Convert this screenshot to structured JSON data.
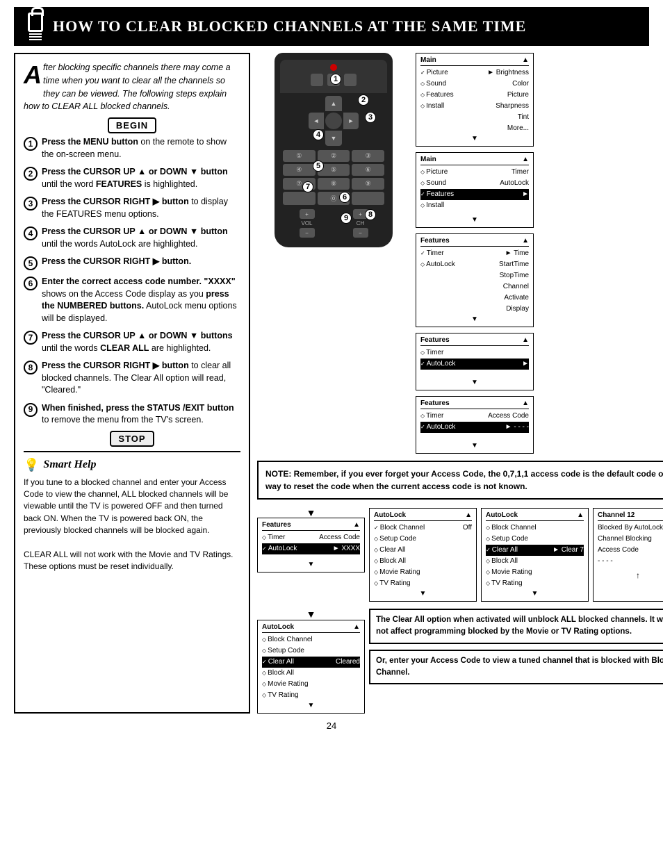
{
  "header": {
    "title": "How to Clear Blocked Channels at the Same Time"
  },
  "intro": {
    "drop_cap": "A",
    "text": "fter blocking specific channels there may come a time when you want to clear all the channels so they can be viewed. The following steps explain how to CLEAR ALL blocked channels."
  },
  "begin_label": "BEGIN",
  "stop_label": "STOP",
  "steps": [
    {
      "num": "1",
      "text": "Press the MENU button on the remote to show the on-screen menu."
    },
    {
      "num": "2",
      "text": "Press the CURSOR UP ▲ or DOWN ▼ button until the word FEATURES is highlighted."
    },
    {
      "num": "3",
      "text": "Press the CURSOR RIGHT ▶ button to display the FEATURES menu options."
    },
    {
      "num": "4",
      "text": "Press the CURSOR UP ▲ or DOWN ▼ button until the words AutoLock are highlighted."
    },
    {
      "num": "5",
      "text": "Press the CURSOR RIGHT ▶ button."
    },
    {
      "num": "6",
      "text": "Enter the correct access code number. \"XXXX\" shows on the Access Code display as you press the NUMBERED buttons. AutoLock menu options will be displayed."
    },
    {
      "num": "7",
      "text": "Press the CURSOR UP ▲ or DOWN ▼ buttons until the words CLEAR ALL are highlighted."
    },
    {
      "num": "8",
      "text": "Press the CURSOR RIGHT ▶ button to clear all blocked channels. The Clear All option will read, \"Cleared.\""
    },
    {
      "num": "9",
      "text": "When finished, press the STATUS /EXIT button to remove the menu from the TV's screen."
    }
  ],
  "smart_help": {
    "title": "Smart Help",
    "text": "If you tune to a blocked channel and enter your Access Code to view the channel, ALL blocked channels will be viewable until the TV is powered OFF and then turned back ON. When the TV is powered back ON, the previously blocked channels will be blocked again.\n\nCLEAR ALL will not work with the Movie and TV Ratings. These options must be reset individually."
  },
  "note": {
    "text": "NOTE: Remember, if you ever forget your Access Code, the 0,7,1,1 access code is the default code or a way to reset the code when the current access code is not known."
  },
  "menu_panels": [
    {
      "id": "panel1",
      "title": "Main",
      "title_arrow": "▲",
      "rows": [
        {
          "check": "✓",
          "label": "Picture",
          "right": "►",
          "right_label": "Brightness"
        },
        {
          "diamond": "◇",
          "label": "Sound",
          "right": "",
          "right_label": "Color"
        },
        {
          "diamond": "◇",
          "label": "Features",
          "right": "",
          "right_label": "Picture"
        },
        {
          "diamond": "◇",
          "label": "Install",
          "right": "",
          "right_label": "Sharpness"
        },
        {
          "diamond": "",
          "label": "",
          "right": "",
          "right_label": "Tint"
        },
        {
          "diamond": "",
          "label": "",
          "right": "",
          "right_label": "More..."
        }
      ]
    },
    {
      "id": "panel2",
      "title": "Main",
      "title_arrow": "▲",
      "rows": [
        {
          "diamond": "◇",
          "label": "Picture",
          "right": "",
          "right_label": "Timer"
        },
        {
          "diamond": "◇",
          "label": "Sound",
          "right": "",
          "right_label": "AutoLock"
        },
        {
          "check": "✓",
          "label": "Features",
          "right": "►",
          "right_label": ""
        },
        {
          "diamond": "◇",
          "label": "Install",
          "right": "",
          "right_label": ""
        }
      ]
    },
    {
      "id": "panel3",
      "title": "Features",
      "title_arrow": "▲",
      "rows": [
        {
          "check": "✓",
          "label": "Timer",
          "right": "►",
          "right_label": "Time"
        },
        {
          "diamond": "◇",
          "label": "AutoLock",
          "right": "",
          "right_label": "StartTime"
        },
        {
          "diamond": "",
          "label": "",
          "right": "",
          "right_label": "StopTime"
        },
        {
          "diamond": "",
          "label": "",
          "right": "",
          "right_label": "Channel"
        },
        {
          "diamond": "",
          "label": "",
          "right": "",
          "right_label": "Activate"
        },
        {
          "diamond": "",
          "label": "",
          "right": "",
          "right_label": "Display"
        }
      ]
    },
    {
      "id": "panel4",
      "title": "Features",
      "title_arrow": "▲",
      "rows": [
        {
          "diamond": "◇",
          "label": "Timer",
          "right": "",
          "right_label": ""
        },
        {
          "check": "✓",
          "label": "AutoLock",
          "right": "►",
          "right_label": ""
        }
      ]
    },
    {
      "id": "panel5",
      "title": "Features",
      "title_arrow": "▲",
      "rows": [
        {
          "diamond": "◇",
          "label": "Timer",
          "right": "",
          "right_label": "Access Code"
        },
        {
          "check": "✓",
          "label": "AutoLock",
          "right": "►",
          "right_label": "- - - -"
        }
      ]
    }
  ],
  "bottom_panels_left": {
    "title": "Features",
    "title_arrow": "▲",
    "rows": [
      {
        "diamond": "◇",
        "label": "Timer",
        "right": "",
        "right_label": "Access Code"
      },
      {
        "check": "✓",
        "label": "AutoLock",
        "right": "►",
        "right_label": "XXXX"
      }
    ]
  },
  "bottom_panels_middle": {
    "title": "AutoLock",
    "title_arrow": "▲",
    "rows": [
      {
        "check": "✓",
        "label": "Block Channel",
        "right": "",
        "right_label": "Off"
      },
      {
        "diamond": "◇",
        "label": "Setup Code",
        "right": "",
        "right_label": ""
      },
      {
        "diamond": "◇",
        "label": "Clear All",
        "right": "",
        "right_label": ""
      },
      {
        "diamond": "◇",
        "label": "Block All",
        "right": "",
        "right_label": ""
      },
      {
        "diamond": "◇",
        "label": "Movie Rating",
        "right": "",
        "right_label": ""
      },
      {
        "diamond": "◇",
        "label": "TV Rating",
        "right": "",
        "right_label": ""
      }
    ]
  },
  "bottom_panels_right": {
    "title": "AutoLock",
    "title_arrow": "▲",
    "rows": [
      {
        "diamond": "◇",
        "label": "Block Channel",
        "right": "",
        "right_label": ""
      },
      {
        "diamond": "◇",
        "label": "Setup Code",
        "right": "",
        "right_label": ""
      },
      {
        "check": "✓",
        "label": "Clear All",
        "right": "►",
        "right_label": "Clear 7"
      },
      {
        "diamond": "◇",
        "label": "Block All",
        "right": "",
        "right_label": ""
      },
      {
        "diamond": "◇",
        "label": "Movie Rating",
        "right": "",
        "right_label": ""
      },
      {
        "diamond": "◇",
        "label": "TV Rating",
        "right": "",
        "right_label": ""
      }
    ]
  },
  "bottom_panel_cleared": {
    "title": "AutoLock",
    "title_arrow": "▲",
    "rows": [
      {
        "diamond": "◇",
        "label": "Block Channel",
        "right": "",
        "right_label": ""
      },
      {
        "diamond": "◇",
        "label": "Setup Code",
        "right": "",
        "right_label": ""
      },
      {
        "check": "✓",
        "label": "Clear All",
        "right": "",
        "right_label": "Cleared"
      },
      {
        "diamond": "◇",
        "label": "Block All",
        "right": "",
        "right_label": ""
      },
      {
        "diamond": "◇",
        "label": "Movie Rating",
        "right": "",
        "right_label": ""
      },
      {
        "diamond": "◇",
        "label": "TV Rating",
        "right": "",
        "right_label": ""
      }
    ]
  },
  "bottom_panel_channel": {
    "title": "Channel 12",
    "rows": [
      "Blocked By AutoLock",
      "Channel Blocking",
      "Access Code",
      "- - - -"
    ]
  },
  "captions": {
    "left": "The Clear All option when activated will unblock ALL blocked channels. It will not affect programming blocked by the Movie or TV Rating options.",
    "right": "Or, enter your Access Code to view a tuned channel that is blocked with Block Channel."
  },
  "page_number": "24",
  "numpad_keys": [
    "1",
    "2",
    "3",
    "4",
    "5",
    "6",
    "7",
    "8",
    "9",
    "",
    "0",
    ""
  ],
  "step_overlays": [
    {
      "num": "1",
      "top": "195",
      "left": "440"
    },
    {
      "num": "2",
      "top": "195",
      "left": "510"
    },
    {
      "num": "3",
      "top": "225",
      "left": "555"
    },
    {
      "num": "4",
      "top": "255",
      "left": "452"
    },
    {
      "num": "5",
      "top": "310",
      "left": "452"
    },
    {
      "num": "6",
      "top": "355",
      "left": "500"
    },
    {
      "num": "7",
      "top": "430",
      "left": "452"
    },
    {
      "num": "8",
      "top": "475",
      "left": "575"
    },
    {
      "num": "9",
      "top": "510",
      "left": "540"
    }
  ]
}
